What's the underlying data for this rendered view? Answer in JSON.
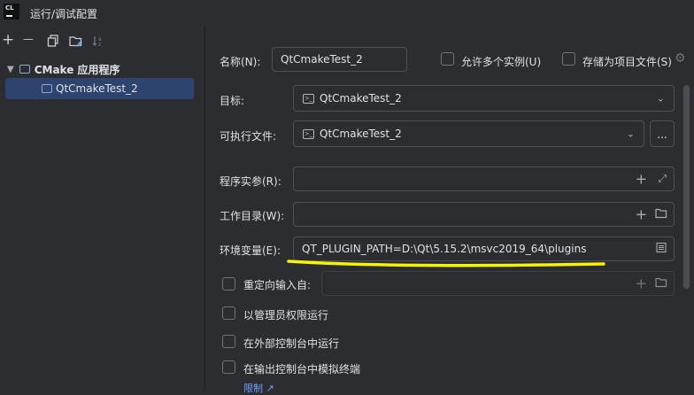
{
  "window": {
    "app_icon_text": "CL",
    "title": "运行/调试配置"
  },
  "toolbar": {
    "add": "+",
    "remove": "—",
    "copy": "copy-icon",
    "new_folder": "folder-add-icon",
    "sort": "sort-icon"
  },
  "tree": {
    "group_label": "CMake 应用程序",
    "items": [
      {
        "label": "QtCmakeTest_2",
        "selected": true
      }
    ]
  },
  "form": {
    "name_label": "名称(N):",
    "name_value": "QtCmakeTest_2",
    "allow_parallel_label": "允许多个实例(U)",
    "store_as_file_label": "存储为项目文件(S)",
    "target_label": "目标:",
    "target_value": "QtCmakeTest_2",
    "executable_label": "可执行文件:",
    "executable_value": "QtCmakeTest_2",
    "browse_label": "...",
    "program_args_label": "程序实参(R):",
    "program_args_value": "",
    "workdir_label": "工作目录(W):",
    "workdir_value": "",
    "env_label": "环境变量(E):",
    "env_value": "QT_PLUGIN_PATH=D:\\Qt\\5.15.2\\msvc2019_64\\plugins",
    "redirect_label": "重定向输入自:",
    "redirect_value": "",
    "run_admin_label": "以管理员权限运行",
    "run_external_label": "在外部控制台中运行",
    "emulate_terminal_label": "在输出控制台中模拟终端",
    "limits_link": "限制"
  },
  "colors": {
    "accent": "#2e436e",
    "highlight": "#f5f500",
    "background": "#2b2d30",
    "border": "#4e5157"
  }
}
